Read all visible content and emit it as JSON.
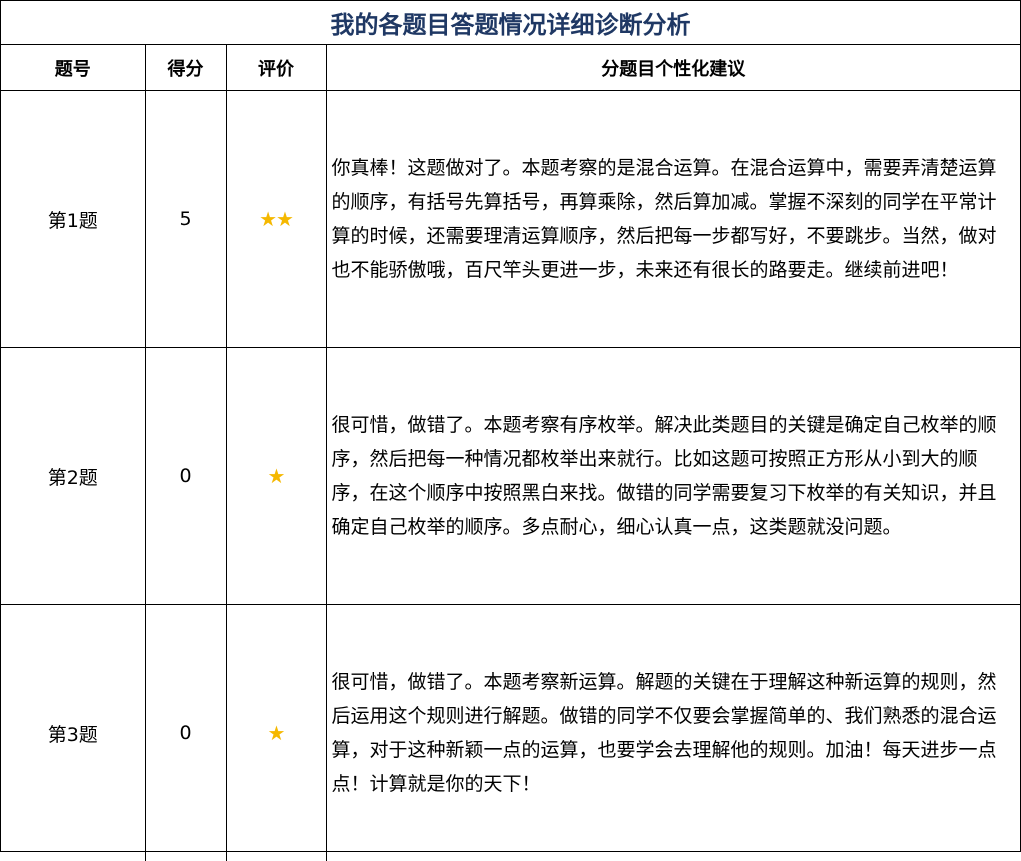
{
  "title": "我的各题目答题情况详细诊断分析",
  "headers": {
    "number": "题号",
    "score": "得分",
    "rating": "评价",
    "advice": "分题目个性化建议"
  },
  "colors": {
    "title": "#1f3864",
    "star": "#f5b800"
  },
  "rows": [
    {
      "number": "第1题",
      "score": "5",
      "rating": "★★",
      "advice": "你真棒！这题做对了。本题考察的是混合运算。在混合运算中，需要弄清楚运算的顺序，有括号先算括号，再算乘除，然后算加减。掌握不深刻的同学在平常计算的时候，还需要理清运算顺序，然后把每一步都写好，不要跳步。当然，做对也不能骄傲哦，百尺竿头更进一步，未来还有很长的路要走。继续前进吧！"
    },
    {
      "number": "第2题",
      "score": "0",
      "rating": "★",
      "advice": "很可惜，做错了。本题考察有序枚举。解决此类题目的关键是确定自己枚举的顺序，然后把每一种情况都枚举出来就行。比如这题可按照正方形从小到大的顺序，在这个顺序中按照黑白来找。做错的同学需要复习下枚举的有关知识，并且确定自己枚举的顺序。多点耐心，细心认真一点，这类题就没问题。"
    },
    {
      "number": "第3题",
      "score": "0",
      "rating": "★",
      "advice": "很可惜，做错了。本题考察新运算。解题的关键在于理解这种新运算的规则，然后运用这个规则进行解题。做错的同学不仅要会掌握简单的、我们熟悉的混合运算，对于这种新颖一点的运算，也要学会去理解他的规则。加油！每天进步一点点！计算就是你的天下！"
    }
  ]
}
